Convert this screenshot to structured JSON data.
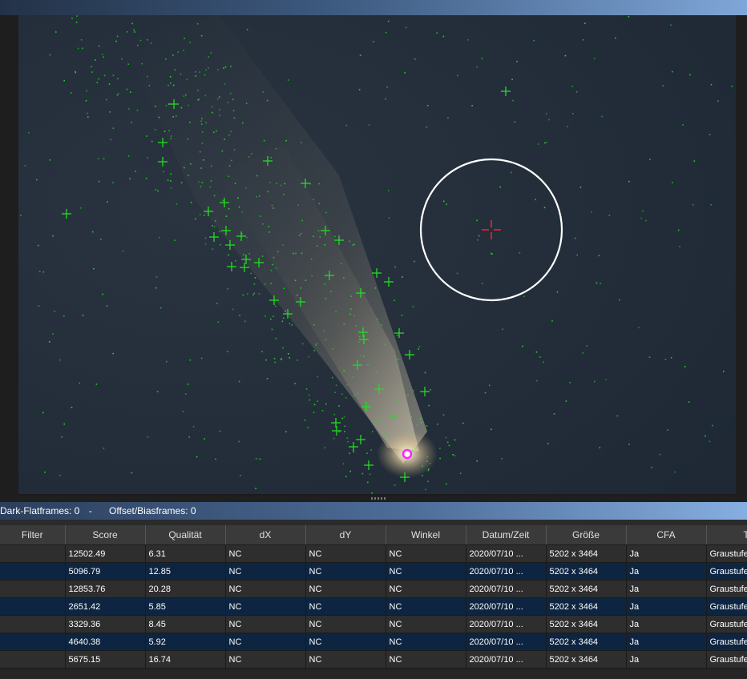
{
  "frames_bar": {
    "dark_flat": "Dark-Flatframes: 0",
    "separator": "-",
    "offset_bias": "Offset/Biasframes: 0"
  },
  "table": {
    "columns": [
      "Filter",
      "Score",
      "Qualität",
      "dX",
      "dY",
      "Winkel",
      "Datum/Zeit",
      "Größe",
      "CFA",
      "Tiefe"
    ],
    "rows": [
      [
        "",
        "12502.49",
        "6.31",
        "NC",
        "NC",
        "NC",
        "2020/07/10 ...",
        "5202 x 3464",
        "Ja",
        "Graustufe"
      ],
      [
        "",
        "5096.79",
        "12.85",
        "NC",
        "NC",
        "NC",
        "2020/07/10 ...",
        "5202 x 3464",
        "Ja",
        "Graustufe"
      ],
      [
        "",
        "12853.76",
        "20.28",
        "NC",
        "NC",
        "NC",
        "2020/07/10 ...",
        "5202 x 3464",
        "Ja",
        "Graustufe"
      ],
      [
        "",
        "2651.42",
        "5.85",
        "NC",
        "NC",
        "NC",
        "2020/07/10 ...",
        "5202 x 3464",
        "Ja",
        "Graustufe"
      ],
      [
        "",
        "3329.36",
        "8.45",
        "NC",
        "NC",
        "NC",
        "2020/07/10 ...",
        "5202 x 3464",
        "Ja",
        "Graustufe"
      ],
      [
        "",
        "4640.38",
        "5.92",
        "NC",
        "NC",
        "NC",
        "2020/07/10 ...",
        "5202 x 3464",
        "Ja",
        "Graustufe"
      ],
      [
        "",
        "5675.15",
        "16.74",
        "NC",
        "NC",
        "NC",
        "2020/07/10 ...",
        "5202 x 3464",
        "Ja",
        "Graustufe"
      ]
    ]
  },
  "image": {
    "star_marker_color": "#22dd22",
    "reference_marker_color": "#ff2020",
    "comet_marker_color": "#ff22ff",
    "selection_circle_color": "#ffffff"
  }
}
